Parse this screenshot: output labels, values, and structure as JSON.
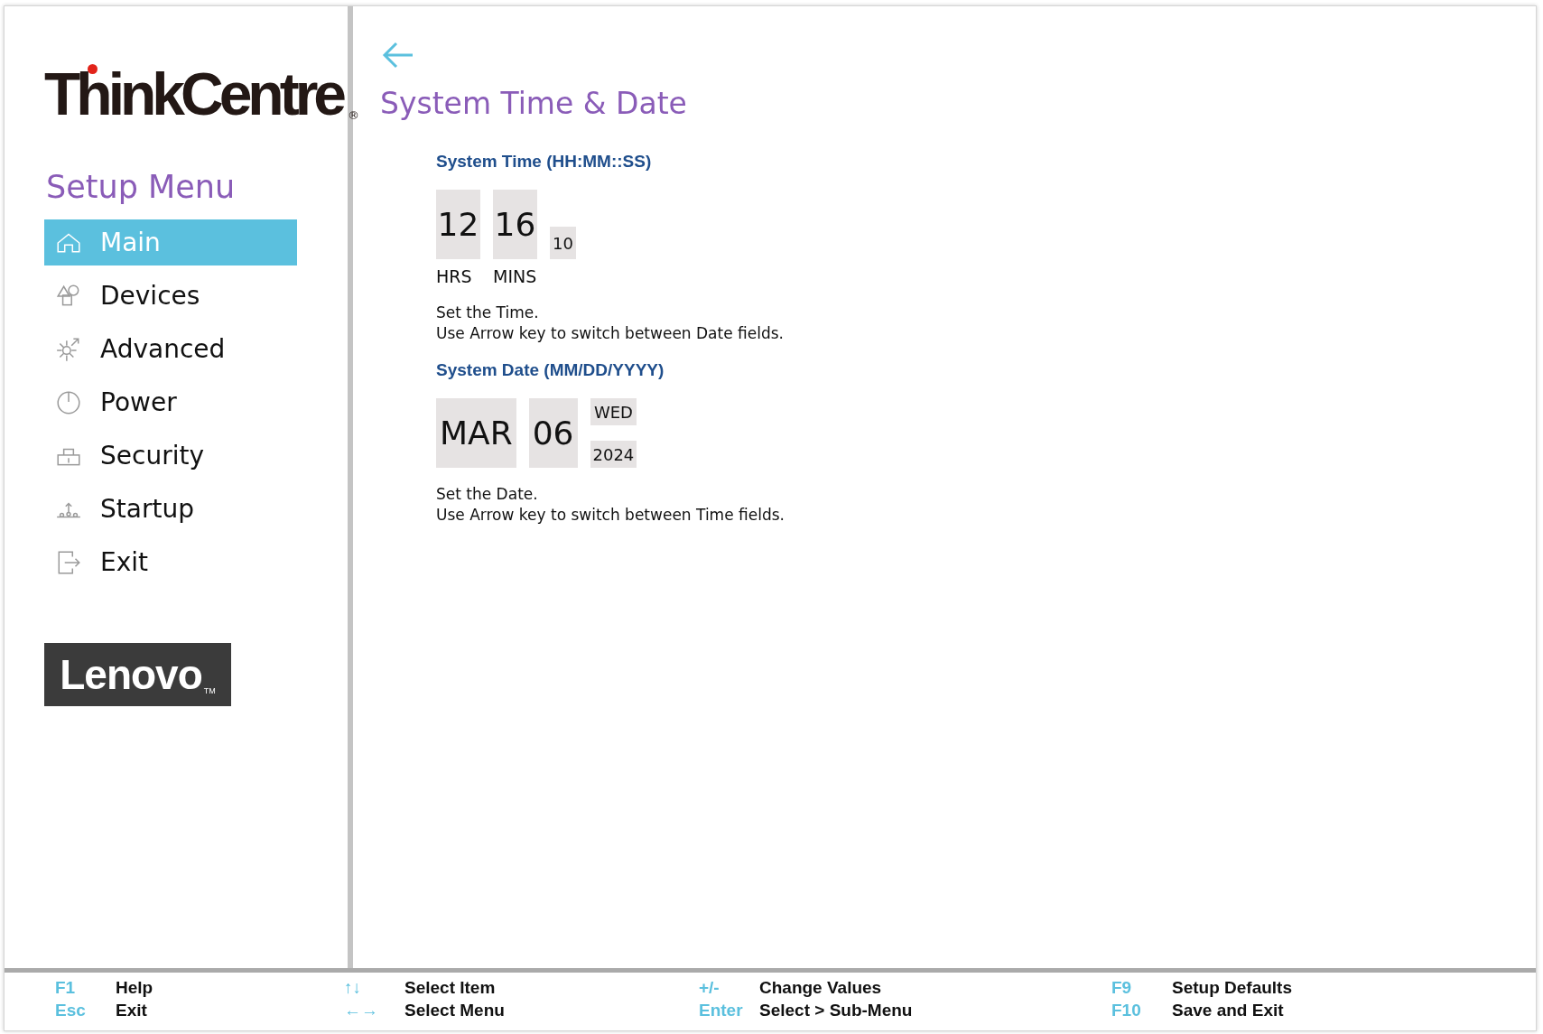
{
  "brand": {
    "product_logo": "ThinkCentre",
    "product_logo_mark": "®",
    "vendor_logo": "Lenovo",
    "vendor_logo_mark": "TM"
  },
  "sidebar": {
    "title": "Setup Menu",
    "items": [
      {
        "label": "Main",
        "kind": "home",
        "selected": true
      },
      {
        "label": "Devices",
        "kind": "devices",
        "selected": false
      },
      {
        "label": "Advanced",
        "kind": "advanced",
        "selected": false
      },
      {
        "label": "Power",
        "kind": "power",
        "selected": false
      },
      {
        "label": "Security",
        "kind": "security",
        "selected": false
      },
      {
        "label": "Startup",
        "kind": "startup",
        "selected": false
      },
      {
        "label": "Exit",
        "kind": "exit",
        "selected": false
      }
    ]
  },
  "page": {
    "title": "System Time & Date",
    "sections": [
      {
        "heading": "System Time (HH:MM::SS)",
        "kind": "time",
        "fields": [
          {
            "value": "12",
            "label": "HRS",
            "kind": "large"
          },
          {
            "value": "16",
            "label": "MINS",
            "kind": "large"
          },
          {
            "value": "10",
            "kind": "small"
          }
        ],
        "help": [
          "Set the Time.",
          "Use Arrow key to switch between Date fields."
        ]
      },
      {
        "heading": "System Date (MM/DD/YYYY)",
        "kind": "date",
        "fields": [
          {
            "value": "MAR",
            "kind": "large"
          },
          {
            "value": "06",
            "kind": "large"
          },
          {
            "value": "WED",
            "kind": "small"
          },
          {
            "value": "2024",
            "kind": "small"
          }
        ],
        "help": [
          "Set the Date.",
          "Use Arrow key to switch between Time fields."
        ]
      }
    ]
  },
  "footer": {
    "columns": [
      [
        {
          "key": "F1",
          "action": "Help"
        },
        {
          "key": "Esc",
          "action": "Exit"
        }
      ],
      [
        {
          "key": "↑↓",
          "action": "Select Item"
        },
        {
          "key": "←→",
          "action": "Select Menu"
        }
      ],
      [
        {
          "key": "+/-",
          "action": "Change Values"
        },
        {
          "key": "Enter",
          "action": "Select > Sub-Menu"
        }
      ],
      [
        {
          "key": "F9",
          "action": "Setup Defaults"
        },
        {
          "key": "F10",
          "action": "Save and Exit"
        }
      ]
    ]
  }
}
